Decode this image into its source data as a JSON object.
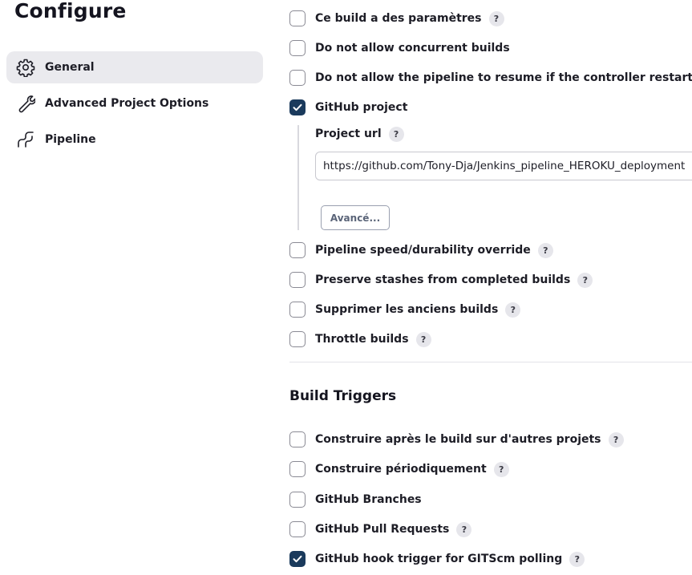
{
  "page": {
    "title": "Configure"
  },
  "colors": {
    "accent": "#1a3a5c",
    "active_bg": "#eaeaee",
    "help_bg": "#e6e6eb"
  },
  "sidebar": {
    "items": [
      {
        "label": "General",
        "icon": "gear-icon",
        "active": true
      },
      {
        "label": "Advanced Project Options",
        "icon": "wrench-icon",
        "active": false
      },
      {
        "label": "Pipeline",
        "icon": "pipeline-icon",
        "active": false
      }
    ]
  },
  "general": {
    "options": [
      {
        "label": "Ce build a des paramètres",
        "checked": false,
        "help": "?"
      },
      {
        "label": "Do not allow concurrent builds",
        "checked": false
      },
      {
        "label": "Do not allow the pipeline to resume if the controller restarts",
        "checked": false
      },
      {
        "label": "GitHub project",
        "checked": true
      },
      {
        "label": "Pipeline speed/durability override",
        "checked": false,
        "help": "?"
      },
      {
        "label": "Preserve stashes from completed builds",
        "checked": false,
        "help": "?"
      },
      {
        "label": "Supprimer les anciens builds",
        "checked": false,
        "help": "?"
      },
      {
        "label": "Throttle builds",
        "checked": false,
        "help": "?"
      }
    ],
    "github_project": {
      "field_label": "Project url",
      "help": "?",
      "url_value": "https://github.com/Tony-Dja/Jenkins_pipeline_HEROKU_deployment",
      "advanced_button": "Avancé..."
    }
  },
  "build_triggers": {
    "title": "Build Triggers",
    "options": [
      {
        "label": "Construire après le build sur d'autres projets",
        "checked": false,
        "help": "?"
      },
      {
        "label": "Construire périodiquement",
        "checked": false,
        "help": "?"
      },
      {
        "label": "GitHub Branches",
        "checked": false
      },
      {
        "label": "GitHub Pull Requests",
        "checked": false,
        "help": "?"
      },
      {
        "label": "GitHub hook trigger for GITScm polling",
        "checked": true,
        "help": "?"
      }
    ]
  }
}
